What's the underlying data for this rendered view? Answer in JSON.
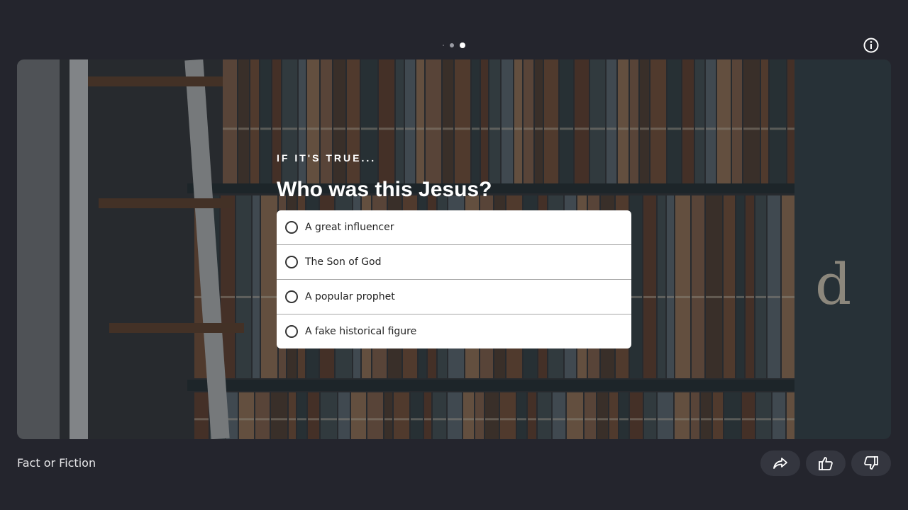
{
  "pager": {
    "count": 3,
    "active_index": 2
  },
  "card": {
    "eyebrow": "IF IT'S TRUE...",
    "question": "Who was this Jesus?",
    "options": [
      {
        "label": "A great influencer"
      },
      {
        "label": "The Son of God"
      },
      {
        "label": "A popular prophet"
      },
      {
        "label": "A fake historical figure"
      }
    ],
    "background": "library-bookshelf-photo",
    "shelf_letter": "d"
  },
  "footer": {
    "title": "Fact or Fiction"
  },
  "icons": {
    "info": "info-icon",
    "share": "share-icon",
    "like": "thumbs-up-icon",
    "dislike": "thumbs-down-icon"
  },
  "colors": {
    "page_bg": "#24252d",
    "button_bg": "#34363f",
    "option_bg": "#ffffff"
  }
}
